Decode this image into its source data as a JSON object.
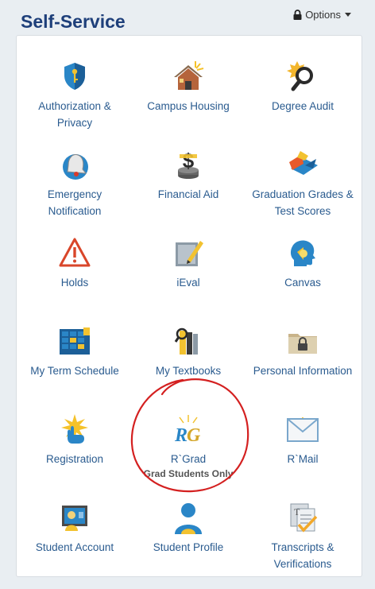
{
  "header": {
    "title": "Self-Service",
    "options_label": "Options"
  },
  "tiles": [
    {
      "label": "Authorization & Privacy",
      "icon": "shield-key-icon"
    },
    {
      "label": "Campus Housing",
      "icon": "house-icon"
    },
    {
      "label": "Degree Audit",
      "icon": "magnifier-icon"
    },
    {
      "label": "Emergency Notification",
      "icon": "bell-icon"
    },
    {
      "label": "Financial Aid",
      "icon": "money-stack-icon"
    },
    {
      "label": "Graduation Grades & Test Scores",
      "icon": "graduation-icon"
    },
    {
      "label": "Holds",
      "icon": "warning-icon"
    },
    {
      "label": "iEval",
      "icon": "pencil-note-icon"
    },
    {
      "label": "Canvas",
      "icon": "head-icon"
    },
    {
      "label": "My Term Schedule",
      "icon": "calendar-grid-icon"
    },
    {
      "label": "My Textbooks",
      "icon": "books-icon"
    },
    {
      "label": "Personal Information",
      "icon": "locked-folder-icon"
    },
    {
      "label": "Registration",
      "icon": "hand-star-icon"
    },
    {
      "label": "R`Grad",
      "sublabel": "Grad Students Only",
      "icon": "rg-logo-icon"
    },
    {
      "label": "R`Mail",
      "icon": "envelope-icon"
    },
    {
      "label": "Student Account",
      "icon": "account-board-icon"
    },
    {
      "label": "Student Profile",
      "icon": "person-icon"
    },
    {
      "label": "Transcripts & Verifications",
      "icon": "documents-icon"
    }
  ],
  "colors": {
    "title": "#1e3f7a",
    "link": "#2a5b8f",
    "annotation": "#d42020"
  }
}
